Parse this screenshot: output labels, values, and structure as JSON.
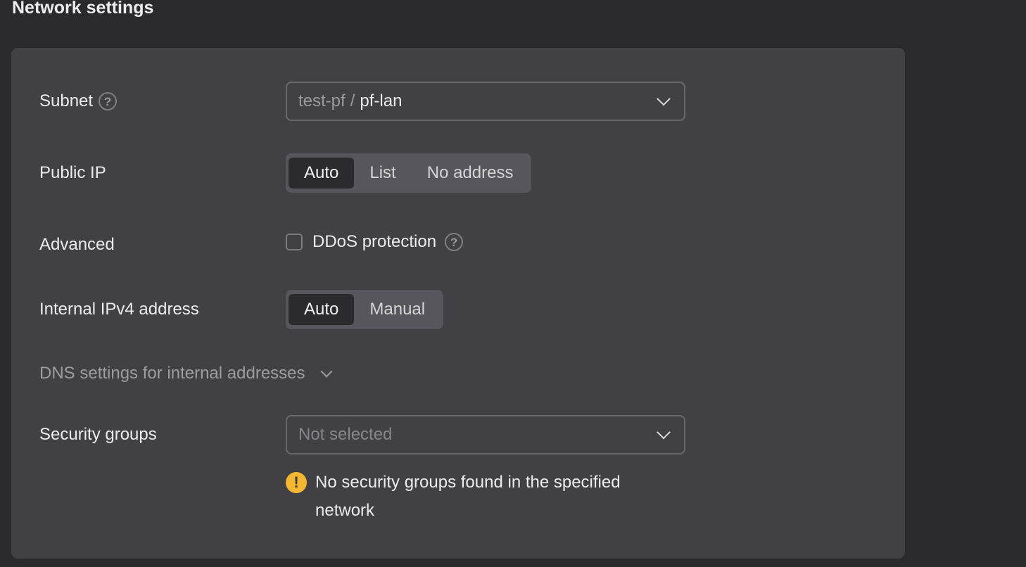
{
  "section": {
    "title": "Network settings"
  },
  "subnet": {
    "label": "Subnet",
    "help": "?",
    "prefix": "test-pf",
    "separator": "/",
    "value": "pf-lan"
  },
  "public_ip": {
    "label": "Public IP",
    "options": [
      "Auto",
      "List",
      "No address"
    ],
    "selected": "Auto"
  },
  "advanced": {
    "label": "Advanced",
    "ddos_label": "DDoS protection",
    "ddos_checked": false,
    "help": "?"
  },
  "internal_ipv4": {
    "label": "Internal IPv4 address",
    "options": [
      "Auto",
      "Manual"
    ],
    "selected": "Auto"
  },
  "dns": {
    "label": "DNS settings for internal addresses"
  },
  "security_groups": {
    "label": "Security groups",
    "placeholder": "Not selected",
    "warning_icon": "!",
    "warning": "No security groups found in the specified network"
  }
}
